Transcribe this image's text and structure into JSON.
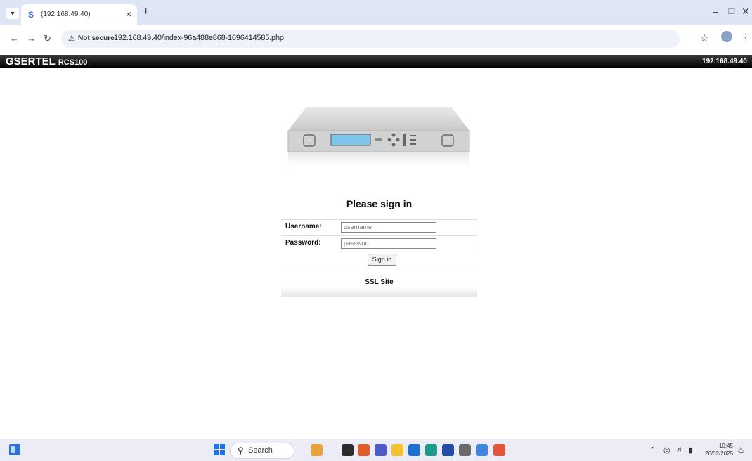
{
  "browser": {
    "tab_title": "(192.168.49.40)",
    "tab_close": "×",
    "new_tab": "+",
    "security_label": "Not secure",
    "url": "192.168.49.40/index-96a488e868-1696414585.php"
  },
  "site": {
    "brand": "GSERTEL",
    "model": "RCS100",
    "ip": "192.168.49.40"
  },
  "login": {
    "title": "Please sign in",
    "username_label": "Username:",
    "username_placeholder": "username",
    "password_label": "Password:",
    "password_placeholder": "password",
    "signin_label": "Sign in",
    "ssl_link": "SSL Site"
  },
  "taskbar": {
    "search_label": "Search",
    "time": "10:45",
    "date": "26/02/2025",
    "app_colors": [
      "#e8a33a",
      "#2b2b2b",
      "#e25b2a",
      "#5059c9",
      "#f2c230",
      "#1f6fd1",
      "#1e9a8a",
      "#1f4fa8",
      "#6a6a6a",
      "#3f86e0",
      "#e2553b"
    ]
  }
}
